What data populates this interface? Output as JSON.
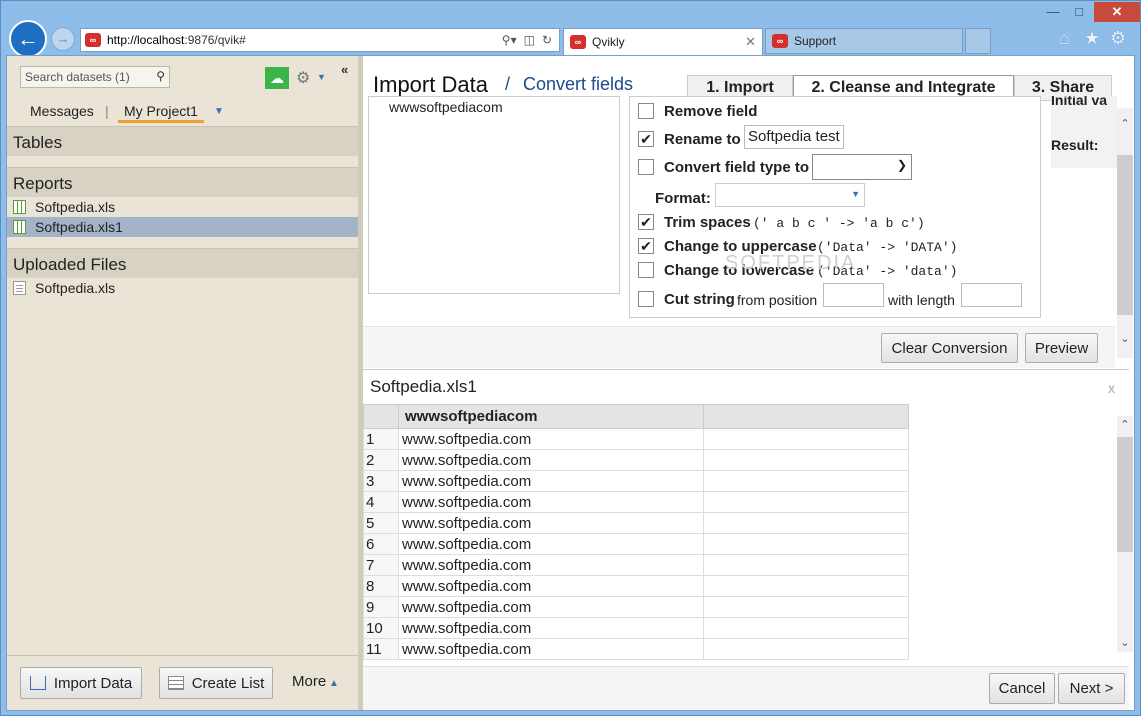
{
  "browser": {
    "url_host": "http://localhost",
    "url_rest": ":9876/qvik#",
    "tabs": [
      {
        "label": "Qvikly",
        "active": true
      },
      {
        "label": "Support",
        "active": false
      }
    ],
    "favicon_text": "∞"
  },
  "sidebar": {
    "search_placeholder": "Search datasets (1)",
    "tabs": {
      "messages": "Messages",
      "separator": "|",
      "project": "My Project1"
    },
    "sections": {
      "tables": "Tables",
      "reports": "Reports",
      "uploaded": "Uploaded Files"
    },
    "reports": [
      {
        "name": "Softpedia.xls",
        "selected": false
      },
      {
        "name": "Softpedia.xls1",
        "selected": true
      }
    ],
    "uploaded_files": [
      {
        "name": "Softpedia.xls"
      }
    ],
    "footer": {
      "import_label": "Import Data",
      "create_list_label": "Create List",
      "more_label": "More"
    }
  },
  "main": {
    "title": "Import Data",
    "title_slash": "/",
    "subtitle": "Convert fields",
    "steps": [
      "1. Import",
      "2. Cleanse and Integrate",
      "3. Share"
    ],
    "active_step": 2,
    "fields": [
      "wwwsoftpediacom"
    ],
    "options": {
      "remove": {
        "label": "Remove field",
        "checked": false
      },
      "rename": {
        "label": "Rename to",
        "checked": true,
        "value": "Softpedia test"
      },
      "convert": {
        "label": "Convert field type to",
        "checked": false,
        "value": ""
      },
      "format": {
        "label": "Format:",
        "value": ""
      },
      "trim": {
        "label": "Trim spaces",
        "checked": true,
        "example": "(' a b c ' -> 'a b c')"
      },
      "upper": {
        "label": "Change to uppercase",
        "checked": true,
        "example": "('Data' -> 'DATA')"
      },
      "lower": {
        "label": "Change to lowercase",
        "checked": false,
        "example": "('Data' -> 'data')"
      },
      "cut": {
        "label": "Cut string",
        "checked": false,
        "from_label": "from position",
        "length_label": "with length",
        "from_value": "",
        "length_value": ""
      }
    },
    "side": {
      "initial_label": "Initial va",
      "result_label": "Result:"
    },
    "clear_label": "Clear Conversion",
    "preview_label": "Preview",
    "watermark": "SOFTPEDIA"
  },
  "preview": {
    "title": "Softpedia.xls1",
    "close_glyph": "x",
    "column_header": "wwwsoftpediacom",
    "rows": [
      {
        "n": "1",
        "v": "www.softpedia.com"
      },
      {
        "n": "2",
        "v": "www.softpedia.com"
      },
      {
        "n": "3",
        "v": "www.softpedia.com"
      },
      {
        "n": "4",
        "v": "www.softpedia.com"
      },
      {
        "n": "5",
        "v": "www.softpedia.com"
      },
      {
        "n": "6",
        "v": "www.softpedia.com"
      },
      {
        "n": "7",
        "v": "www.softpedia.com"
      },
      {
        "n": "8",
        "v": "www.softpedia.com"
      },
      {
        "n": "9",
        "v": "www.softpedia.com"
      },
      {
        "n": "10",
        "v": "www.softpedia.com"
      },
      {
        "n": "11",
        "v": "www.softpedia.com"
      }
    ]
  },
  "footer": {
    "cancel_label": "Cancel",
    "next_label": "Next >"
  },
  "icons": {
    "back": "arrow-left-icon",
    "forward": "arrow-right-icon",
    "search": "magnifier-icon",
    "refresh": "refresh-icon",
    "home": "home-icon",
    "favorites": "star-icon",
    "tools": "gear-icon"
  },
  "colors": {
    "accent": "#1c4a8c",
    "selected": "#a3b3c8",
    "tab_underline": "#f0a030",
    "cloud_button": "#3bb54a"
  }
}
